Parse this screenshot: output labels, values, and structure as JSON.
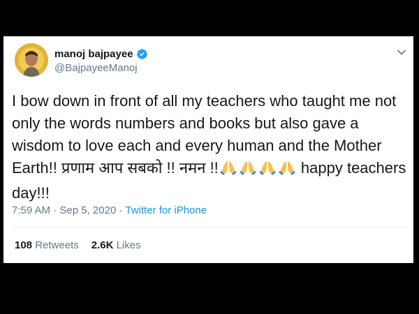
{
  "tweet": {
    "display_name": "manoj bajpayee",
    "handle": "@BajpayeeManoj",
    "text_main": "I bow down in front of all my teachers who taught me not only the words numbers and books but also gave a wisdom to love each and every human and the Mother Earth!! प्रणाम आप सबको !! नमन !!",
    "text_tail": " happy teachers day!!!",
    "emoji": [
      "folded-hands",
      "folded-hands",
      "folded-hands",
      "folded-hands"
    ],
    "time": "7:59 AM",
    "separator": " · ",
    "date": "Sep 5, 2020",
    "source": "Twitter for iPhone",
    "retweets_count": "108",
    "retweets_label": "Retweets",
    "likes_count": "2.6K",
    "likes_label": "Likes"
  },
  "icons": {
    "verified": "verified-badge-icon",
    "menu": "chevron-down-icon"
  },
  "colors": {
    "background": "#000000",
    "card": "#ffffff",
    "text": "#14171a",
    "secondary": "#657786",
    "link": "#1b95e0",
    "verified": "#1da1f2"
  }
}
